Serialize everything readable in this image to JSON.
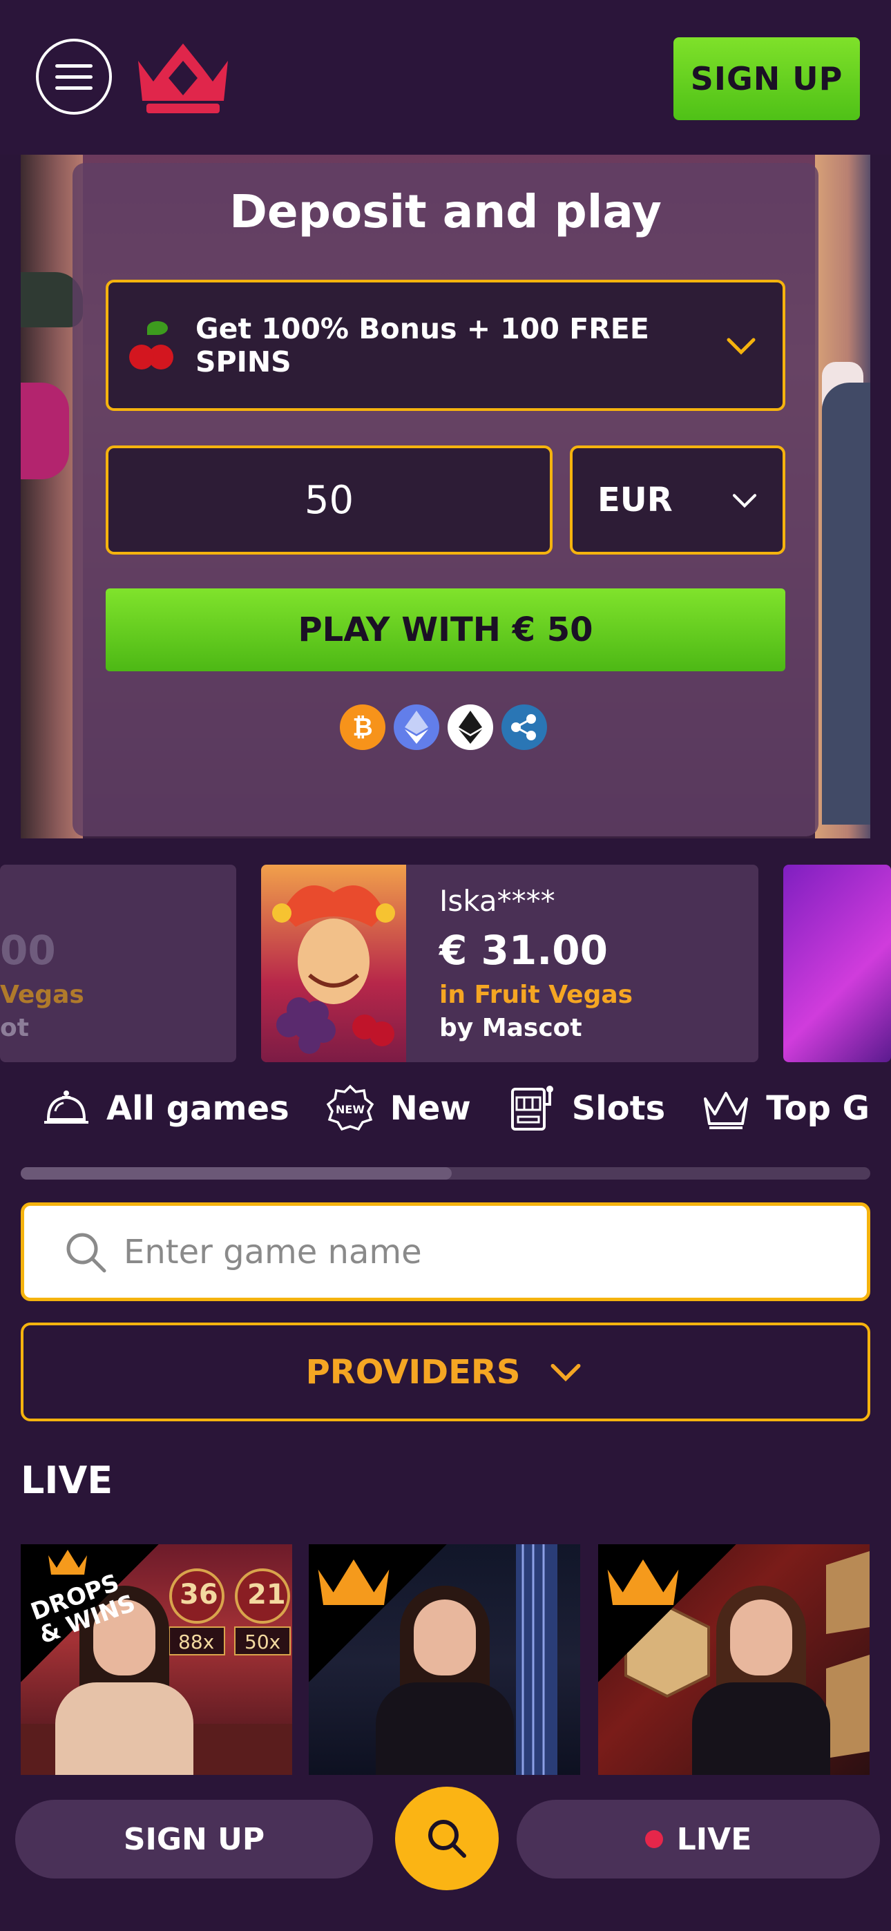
{
  "header": {
    "signup_label": "SIGN UP"
  },
  "deposit": {
    "title": "Deposit and play",
    "bonus_label": "Get 100% Bonus + 100 FREE SPINS",
    "amount_value": "50",
    "currency": "EUR",
    "play_label": "PLAY WITH € 50",
    "crypto_icons": [
      "bitcoin-icon",
      "ethereum-icon",
      "ethereum-classic-icon",
      "ripple-icon"
    ]
  },
  "winners": {
    "left": {
      "amount": "00",
      "game": "Vegas",
      "provider": "ot"
    },
    "current": {
      "name": "Iska****",
      "amount": "€ 31.00",
      "game": "in Fruit Vegas",
      "provider": "by Mascot"
    }
  },
  "categories": [
    {
      "label": "All games",
      "icon": "bell-icon"
    },
    {
      "label": "New",
      "icon": "new-badge-icon"
    },
    {
      "label": "Slots",
      "icon": "slot-machine-icon"
    },
    {
      "label": "Top G",
      "icon": "crown-icon"
    }
  ],
  "search": {
    "placeholder": "Enter game name"
  },
  "providers_label": "PROVIDERS",
  "live_section": {
    "title": "LIVE",
    "badge": "DROPS & WINS",
    "roulette_numbers": [
      "36",
      "21"
    ],
    "multipliers": [
      "88x",
      "50x"
    ]
  },
  "bottom_bar": {
    "signup_label": "SIGN UP",
    "live_label": "LIVE"
  },
  "colors": {
    "background": "#2a1538",
    "accent_orange": "#f5b30e",
    "accent_green": "#5cc91c",
    "live_red": "#e6264a"
  }
}
